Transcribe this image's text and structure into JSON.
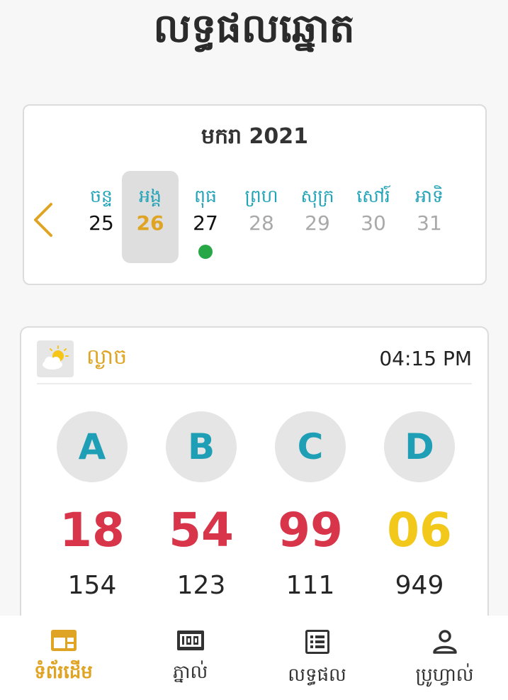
{
  "header": {
    "title": "លទ្ធផលឆ្នោត"
  },
  "calendar": {
    "month_label": "មករា 2021",
    "days": [
      {
        "name": "ចន្ទ",
        "number": "25",
        "state": "past"
      },
      {
        "name": "អង្គ",
        "number": "26",
        "state": "selected"
      },
      {
        "name": "ពុធ",
        "number": "27",
        "state": "past",
        "has_result": true
      },
      {
        "name": "ព្រហ",
        "number": "28",
        "state": "future"
      },
      {
        "name": "សុក្រ",
        "number": "29",
        "state": "future"
      },
      {
        "name": "សៅរ៍",
        "number": "30",
        "state": "future"
      },
      {
        "name": "អាទិ",
        "number": "31",
        "state": "future"
      }
    ]
  },
  "result": {
    "session_label": "ល្ងាច",
    "time": "04:15 PM",
    "weather_icon": "sun-cloud-icon",
    "columns": [
      {
        "letter": "A",
        "two_digit": "18",
        "three_digit": "154",
        "highlight": "red"
      },
      {
        "letter": "B",
        "two_digit": "54",
        "three_digit": "123",
        "highlight": "red"
      },
      {
        "letter": "C",
        "two_digit": "99",
        "three_digit": "111",
        "highlight": "red"
      },
      {
        "letter": "D",
        "two_digit": "06",
        "three_digit": "949",
        "highlight": "gold"
      }
    ]
  },
  "nav": {
    "items": [
      {
        "label": "ទំព័រដើម",
        "icon": "home-dashboard-icon",
        "active": true
      },
      {
        "label": "ភ្នាល់",
        "icon": "ticket-icon",
        "active": false
      },
      {
        "label": "លទ្ធផល",
        "icon": "list-icon",
        "active": false
      },
      {
        "label": "ប្រូហ្វាល់",
        "icon": "profile-icon",
        "active": false
      }
    ]
  },
  "colors": {
    "accent": "#e0a424",
    "teal": "#22a3b8",
    "red": "#d8344a",
    "gold": "#f2c81a",
    "green_dot": "#27a746"
  }
}
